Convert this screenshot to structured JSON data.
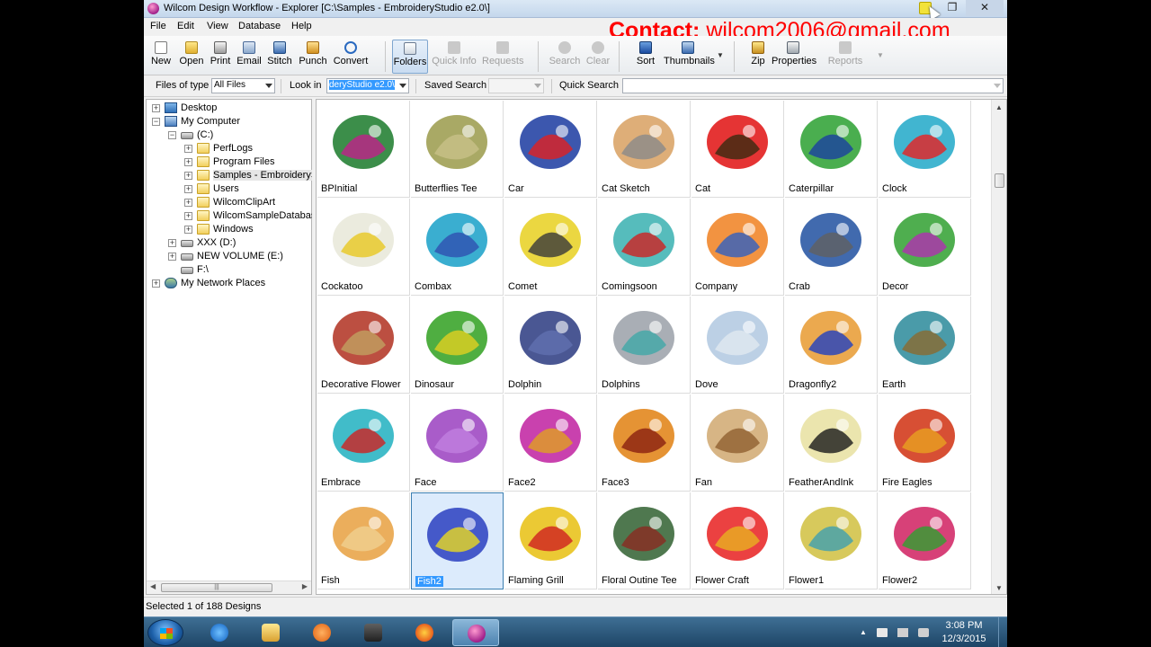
{
  "window": {
    "title": "Wilcom Design Workflow - Explorer  [C:\\Samples - EmbroideryStudio e2.0\\]"
  },
  "contact": {
    "label": "Contact:",
    "email": "wilcom2006@gmail.com"
  },
  "menu": [
    "File",
    "Edit",
    "View",
    "Database",
    "Help"
  ],
  "toolbar": {
    "new": "New",
    "open": "Open",
    "print": "Print",
    "email": "Email",
    "stitch": "Stitch",
    "punch": "Punch",
    "convert": "Convert",
    "folders": "Folders",
    "quick_info": "Quick Info",
    "requests": "Requests",
    "search": "Search",
    "clear": "Clear",
    "sort": "Sort",
    "thumbnails": "Thumbnails",
    "zip": "Zip",
    "properties": "Properties",
    "reports": "Reports"
  },
  "filterbar": {
    "files_of_type_label": "Files of type",
    "files_of_type_value": "All Files",
    "look_in_label": "Look in",
    "look_in_value": "deryStudio e2.0\\",
    "saved_search_label": "Saved Search",
    "quick_search_label": "Quick Search"
  },
  "tree": {
    "items": [
      {
        "label": "Desktop",
        "level": 0,
        "icon": "desktop-icon",
        "exp": "+"
      },
      {
        "label": "My Computer",
        "level": 0,
        "icon": "computer-icon",
        "exp": "-"
      },
      {
        "label": "(C:)",
        "level": 1,
        "icon": "drive-icon",
        "exp": "-"
      },
      {
        "label": "PerfLogs",
        "level": 2,
        "icon": "folder-icon",
        "exp": "+"
      },
      {
        "label": "Program Files",
        "level": 2,
        "icon": "folder-icon",
        "exp": "+"
      },
      {
        "label": "Samples - EmbroideryStu",
        "level": 2,
        "icon": "folder-icon",
        "exp": "+",
        "highlight": true
      },
      {
        "label": "Users",
        "level": 2,
        "icon": "folder-icon",
        "exp": "+"
      },
      {
        "label": "WilcomClipArt",
        "level": 2,
        "icon": "folder-icon",
        "exp": "+"
      },
      {
        "label": "WilcomSampleDatabase",
        "level": 2,
        "icon": "folder-icon",
        "exp": "+"
      },
      {
        "label": "Windows",
        "level": 2,
        "icon": "folder-icon",
        "exp": "+"
      },
      {
        "label": "XXX (D:)",
        "level": 1,
        "icon": "drive-icon",
        "exp": "+"
      },
      {
        "label": "NEW VOLUME (E:)",
        "level": 1,
        "icon": "drive-icon",
        "exp": "+"
      },
      {
        "label": "F:\\",
        "level": 1,
        "icon": "drive-icon",
        "exp": ""
      },
      {
        "label": "My Network Places",
        "level": 0,
        "icon": "network-icon",
        "exp": "+"
      }
    ]
  },
  "designs": [
    {
      "name": "BPInitial",
      "color": "#1a7a2a",
      "accent": "#c0208a"
    },
    {
      "name": "Butterflies Tee",
      "color": "#9a9a4a",
      "accent": "#c8c088"
    },
    {
      "name": "Car",
      "color": "#1a3aa0",
      "accent": "#e02020"
    },
    {
      "name": "Cat Sketch",
      "color": "#d8a060",
      "accent": "#8a8a8a"
    },
    {
      "name": "Cat",
      "color": "#e01010",
      "accent": "#3a2a10"
    },
    {
      "name": "Caterpillar",
      "color": "#2aa030",
      "accent": "#1a40a0"
    },
    {
      "name": "Clock",
      "color": "#20a8c8",
      "accent": "#e82020"
    },
    {
      "name": "Cockatoo",
      "color": "#e8e8d8",
      "accent": "#e8c820"
    },
    {
      "name": "Combax",
      "color": "#18a0c8",
      "accent": "#3050b0"
    },
    {
      "name": "Comet",
      "color": "#e8d020",
      "accent": "#3a3a3a"
    },
    {
      "name": "Comingsoon",
      "color": "#38b0b0",
      "accent": "#d02020"
    },
    {
      "name": "Company",
      "color": "#f08020",
      "accent": "#3060c0"
    },
    {
      "name": "Crab",
      "color": "#2050a0",
      "accent": "#606060"
    },
    {
      "name": "Decor",
      "color": "#30a030",
      "accent": "#b030b0"
    },
    {
      "name": "Decorative Flower",
      "color": "#b03020",
      "accent": "#c0a060"
    },
    {
      "name": "Dinosaur",
      "color": "#30a020",
      "accent": "#e0d020"
    },
    {
      "name": "Dolphin",
      "color": "#2a3a80",
      "accent": "#6070b0"
    },
    {
      "name": "Dolphins",
      "color": "#9aa0a8",
      "accent": "#40a8a8"
    },
    {
      "name": "Dove",
      "color": "#b0c8e0",
      "accent": "#e0e8f0"
    },
    {
      "name": "Dragonfly2",
      "color": "#e89a30",
      "accent": "#2040c0"
    },
    {
      "name": "Earth",
      "color": "#2a8a9a",
      "accent": "#8a6a30"
    },
    {
      "name": "Embrace",
      "color": "#20b0c0",
      "accent": "#d02020"
    },
    {
      "name": "Face",
      "color": "#9a40c0",
      "accent": "#c080e0"
    },
    {
      "name": "Face2",
      "color": "#c020a0",
      "accent": "#e0a020"
    },
    {
      "name": "Face3",
      "color": "#e08010",
      "accent": "#8a2010"
    },
    {
      "name": "Fan",
      "color": "#d0a870",
      "accent": "#906030"
    },
    {
      "name": "FeatherAndInk",
      "color": "#e8e0a0",
      "accent": "#1a1a1a"
    },
    {
      "name": "Fire Eagles",
      "color": "#d03010",
      "accent": "#e8a020"
    },
    {
      "name": "Fish",
      "color": "#e8a040",
      "accent": "#f0d090"
    },
    {
      "name": "Fish2",
      "color": "#2a40c0",
      "accent": "#e8d820",
      "selected": true
    },
    {
      "name": "Flaming Grill",
      "color": "#e8c010",
      "accent": "#d02020"
    },
    {
      "name": "Floral Outine Tee",
      "color": "#306030",
      "accent": "#8a2a20"
    },
    {
      "name": "Flower Craft",
      "color": "#e82020",
      "accent": "#e8b020"
    },
    {
      "name": "Flower1",
      "color": "#d0c040",
      "accent": "#40a0b0"
    },
    {
      "name": "Flower2",
      "color": "#d02060",
      "accent": "#30a030"
    }
  ],
  "statusbar": {
    "text": "Selected 1 of 188 Designs"
  },
  "taskbar": {
    "time": "3:08 PM",
    "date": "12/3/2015"
  }
}
